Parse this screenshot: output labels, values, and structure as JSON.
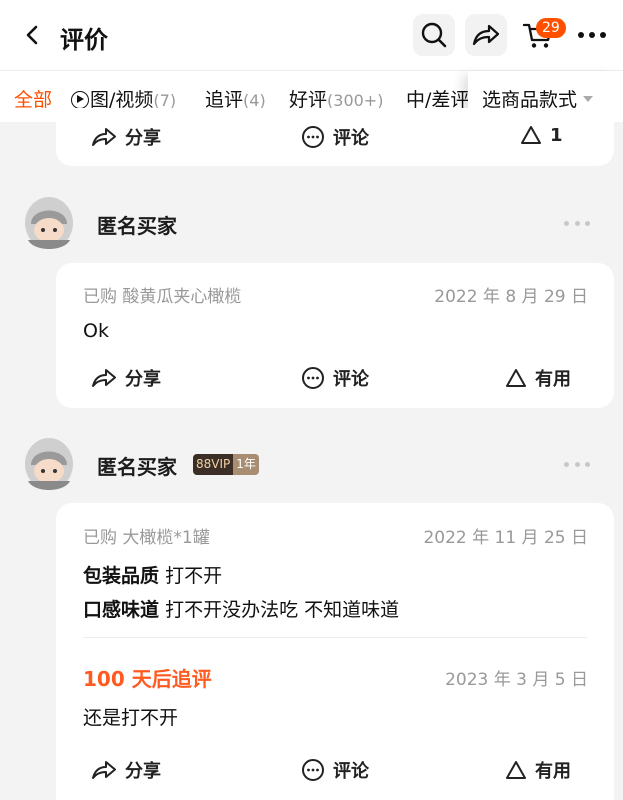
{
  "header": {
    "title": "评价",
    "cart_count": "29"
  },
  "tabs": {
    "all": "全部",
    "media": "图/视频",
    "media_count": "(7)",
    "follow": "追评",
    "follow_count": "(4)",
    "good": "好评",
    "good_count": "(300+)",
    "bad": "中/差评",
    "style_select": "选商品款式"
  },
  "card0": {
    "share": "分享",
    "comment": "评论",
    "like_count": "1"
  },
  "reviews": [
    {
      "username": "匿名买家",
      "purchased": "已购 酸黄瓜夹心橄榄",
      "date": "2022 年 8 月 29 日",
      "text": "Ok",
      "share": "分享",
      "comment": "评论",
      "helpful": "有用"
    },
    {
      "username": "匿名买家",
      "vip_label": "88VIP",
      "vip_years": "1年",
      "purchased": "已购 大橄榄*1罐",
      "date": "2022 年 11 月 25 日",
      "attr1_label": "包装品质",
      "attr1_value": "打不开",
      "attr2_label": "口感味道",
      "attr2_value": "打不开没办法吃 不知道味道",
      "followup_label": "100 天后追评",
      "followup_date": "2023 年 3 月 5 日",
      "followup_text": "还是打不开",
      "share": "分享",
      "comment": "评论",
      "helpful": "有用"
    }
  ],
  "colors": {
    "accent": "#ff5000",
    "followup": "#ff5a1f",
    "muted": "#999999"
  }
}
